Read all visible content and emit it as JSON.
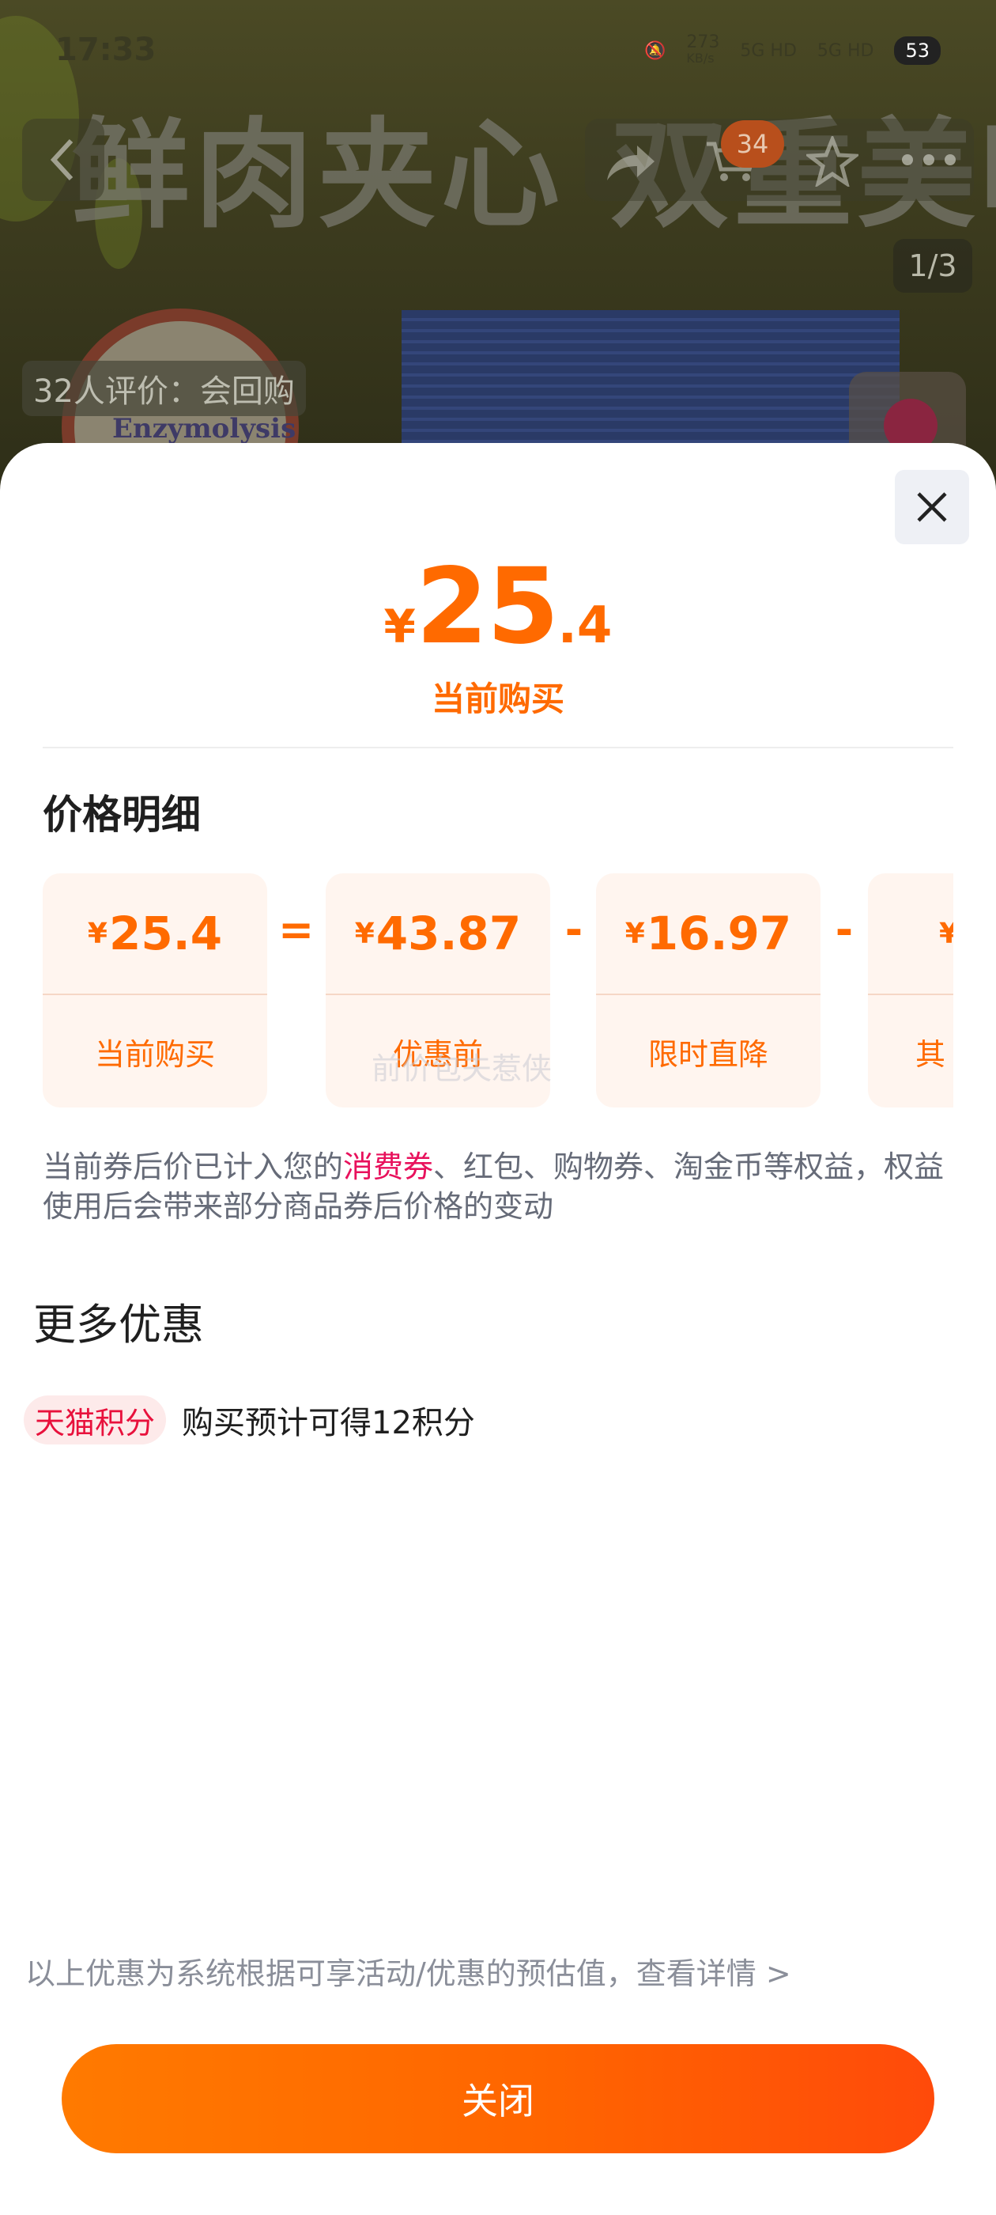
{
  "status_bar": {
    "time": "17:33",
    "net_speed": "273",
    "net_unit": "KB/s",
    "signal1": "5G HD",
    "signal2": "5G HD",
    "battery": "53"
  },
  "background": {
    "promo_title": "鲜肉夹心 双重美味",
    "cart_badge": "34",
    "page_indicator": "1/3",
    "review_chip": "32人评价：会回购",
    "seal_text": "Enzymolysis",
    "icons": [
      "back-icon",
      "share-icon",
      "cart-icon",
      "star-icon",
      "more-icon"
    ]
  },
  "sheet": {
    "close_icon": "close-icon",
    "price": {
      "currency": "¥",
      "integer": "25",
      "decimal": ".4",
      "label": "当前购买"
    },
    "detail_title": "价格明细",
    "breakdown": [
      {
        "value": "25.4",
        "label": "当前购买"
      },
      {
        "value": "43.87",
        "label": "优惠前"
      },
      {
        "value": "16.97",
        "label": "限时直降"
      },
      {
        "value": "",
        "label": "其"
      }
    ],
    "operators": [
      "=",
      "-",
      "-"
    ],
    "watermark": "前价包夫惹侠",
    "note_parts": {
      "before": "当前券后价已计入您的",
      "highlight": "消费券",
      "after": "、红包、购物券、淘金币等权益，权益使用后会带来部分商品券后价格的变动"
    },
    "more_title": "更多优惠",
    "points_tag": "天猫积分",
    "points_text": "购买预计可得12积分",
    "disclaimer": "以上优惠为系统根据可享活动/优惠的预估值，查看详情 >",
    "close_button": "关闭"
  },
  "colors": {
    "accent": "#ff6a00",
    "highlight": "#e8115c",
    "card_bg": "#fff5ef"
  }
}
